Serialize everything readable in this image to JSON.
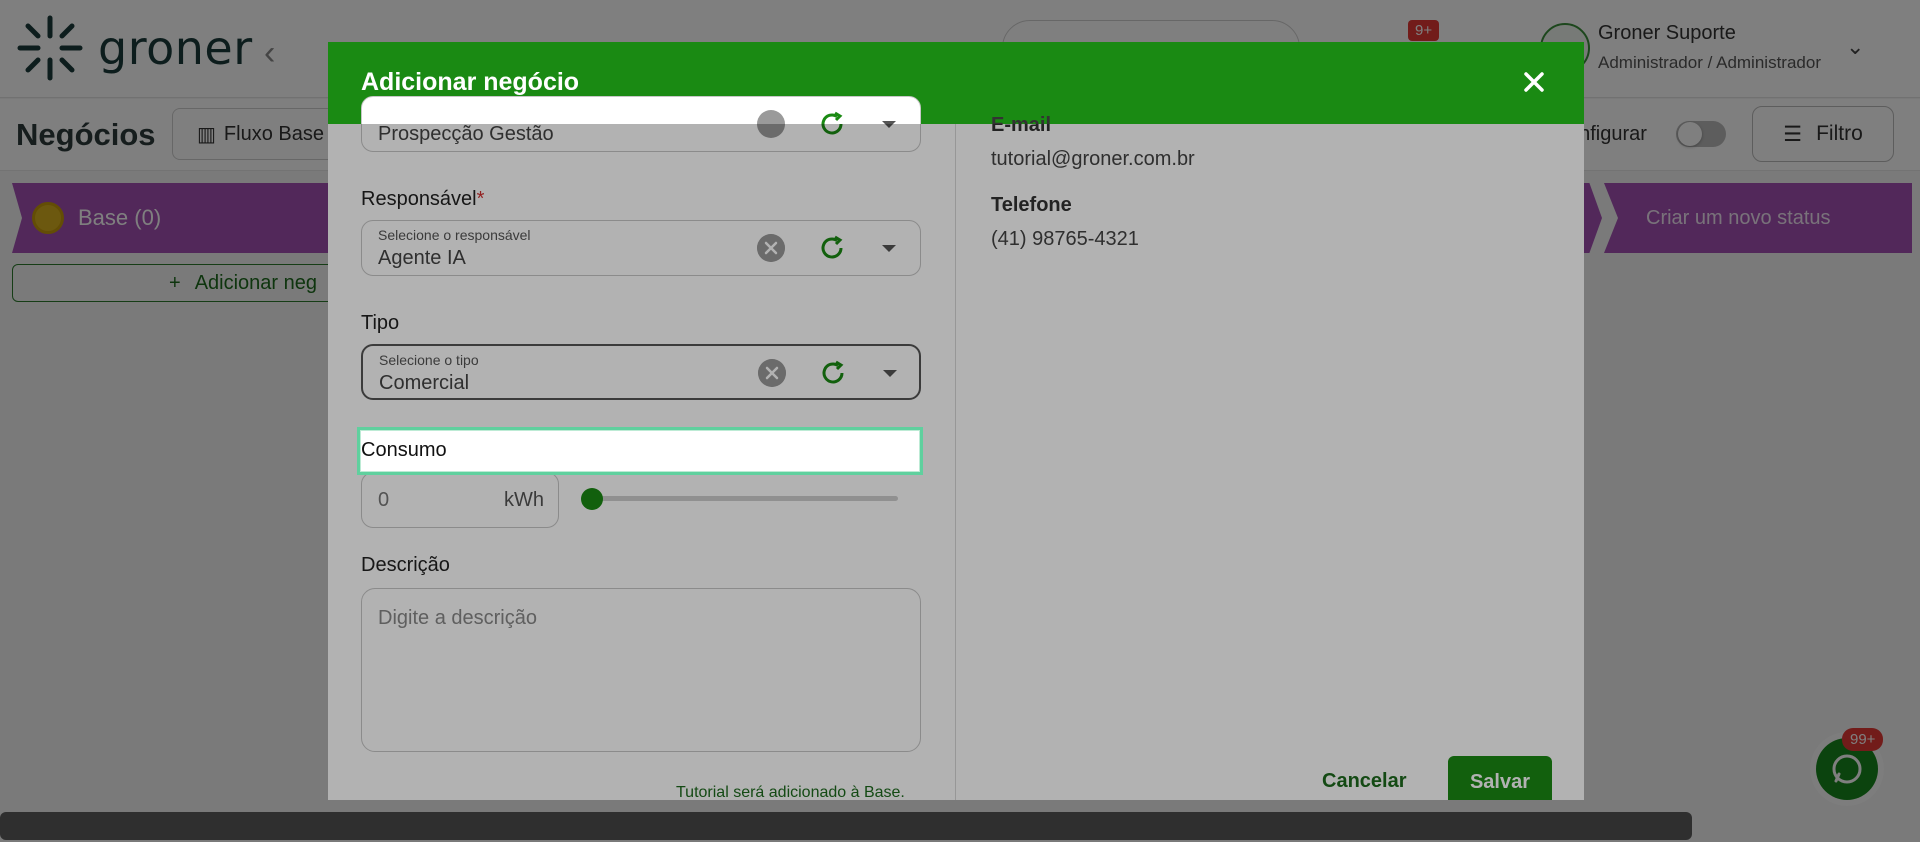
{
  "app": {
    "logo_text": "groner",
    "notification_badge": "9+",
    "user": {
      "name": "Groner Suporte",
      "role": "Administrador / Administrador"
    }
  },
  "page": {
    "title": "Negócios",
    "flow_button": "Fluxo Base",
    "configure_label": "onfigurar",
    "filter_label": "Filtro",
    "stage_label": "Base (0)",
    "new_status_label": "Criar um novo status",
    "add_business_label": "Adicionar neg"
  },
  "whatsapp": {
    "badge": "99+"
  },
  "modal": {
    "title": "Adicionar negócio",
    "funnel_value": "Prospecção Gestão",
    "responsavel": {
      "label": "Responsável",
      "required_mark": "*",
      "hint": "Selecione o responsável",
      "value": "Agente IA"
    },
    "tipo": {
      "label": "Tipo",
      "hint": "Selecione o tipo",
      "value": "Comercial"
    },
    "consumo": {
      "label": "Consumo",
      "value": "0",
      "unit": "kWh",
      "slider_fraction": 0
    },
    "descricao": {
      "label": "Descrição",
      "placeholder": "Digite a descrição"
    },
    "note": "Tutorial será adicionado à Base.",
    "contact": {
      "email_label": "E-mail",
      "email_value": "tutorial@groner.com.br",
      "phone_label": "Telefone",
      "phone_value": "(41) 98765-4321"
    },
    "cancel_label": "Cancelar",
    "save_label": "Salvar"
  },
  "colors": {
    "brand_green": "#1a8a13",
    "stage_purple": "#a451b5",
    "badge_red": "#e53935",
    "focus_teal": "#5fd09e"
  }
}
